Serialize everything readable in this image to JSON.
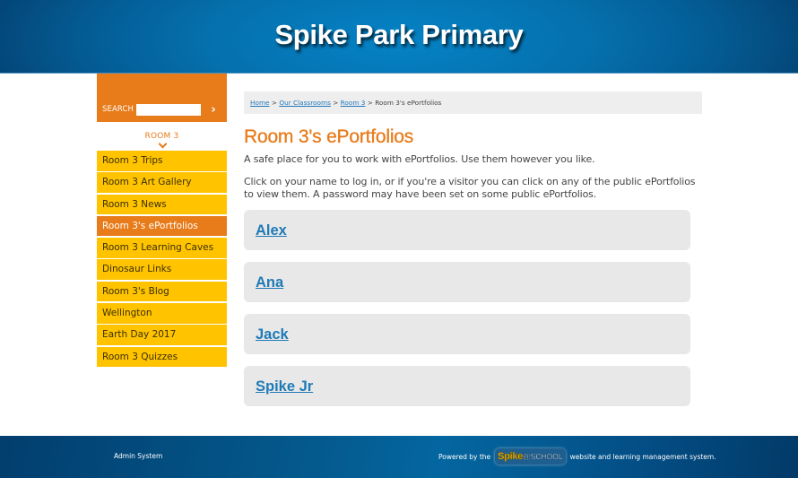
{
  "header": {
    "title": "Spike Park Primary"
  },
  "sidebar": {
    "search": {
      "label": "SEARCH",
      "value": "",
      "placeholder": "",
      "go_icon": "chevron-right-icon",
      "go_glyph": "›"
    },
    "section_heading": "ROOM 3",
    "section_icon": "chevron-down-icon",
    "items": [
      {
        "label": "Room 3 Trips",
        "active": false
      },
      {
        "label": "Room 3 Art Gallery",
        "active": false
      },
      {
        "label": "Room 3 News",
        "active": false
      },
      {
        "label": "Room 3's ePortfolios",
        "active": true
      },
      {
        "label": "Room 3 Learning Caves",
        "active": false
      },
      {
        "label": "Dinosaur Links",
        "active": false
      },
      {
        "label": "Room 3's Blog",
        "active": false
      },
      {
        "label": "Wellington",
        "active": false
      },
      {
        "label": "Earth Day 2017",
        "active": false
      },
      {
        "label": "Room 3 Quizzes",
        "active": false
      }
    ]
  },
  "breadcrumb": {
    "items": [
      {
        "label": "Home",
        "link": true
      },
      {
        "label": "Our Classrooms",
        "link": true
      },
      {
        "label": "Room 3",
        "link": true
      },
      {
        "label": "Room 3's ePortfolios",
        "link": false
      }
    ],
    "separator": ">"
  },
  "main": {
    "title": "Room 3's ePortfolios",
    "intro": "A safe place for you to work with ePortfolios. Use them however you like.",
    "instructions": "Click on your name to log in, or if you're a visitor you can click on any of the public ePortfolios to view them. A password may have been set on some public ePortfolios.",
    "portfolios": [
      {
        "name": "Alex"
      },
      {
        "name": "Ana"
      },
      {
        "name": "Jack"
      },
      {
        "name": "Spike Jr"
      }
    ]
  },
  "footer": {
    "admin_link": "Admin System",
    "powered_prefix": "Powered by the",
    "logo_spike": "Spike",
    "logo_school": "@SCHOOL",
    "powered_suffix": "website and learning management system."
  },
  "colors": {
    "brand_orange": "#e87b1a",
    "nav_yellow": "#ffc300",
    "header_blue": "#0570ad",
    "link_blue": "#1f7ab7",
    "card_gray": "#e8e8e8"
  }
}
